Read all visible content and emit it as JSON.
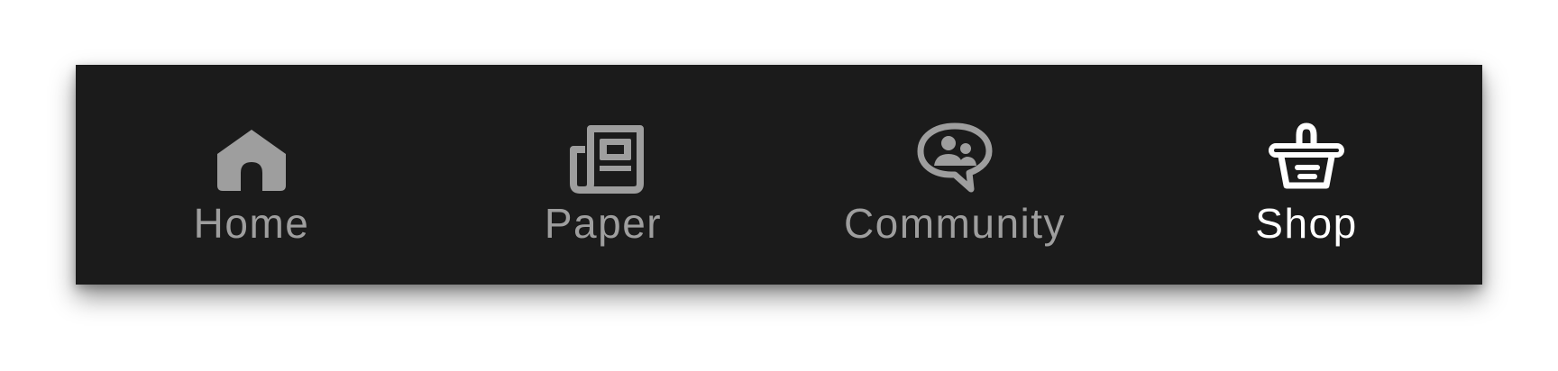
{
  "tab_bar": {
    "selected_index": 3,
    "tabs": [
      {
        "label": "Home",
        "icon": "home-icon",
        "active": false
      },
      {
        "label": "Paper",
        "icon": "newspaper-icon",
        "active": false
      },
      {
        "label": "Community",
        "icon": "community-chat-icon",
        "active": false
      },
      {
        "label": "Shop",
        "icon": "shopping-basket-icon",
        "active": true
      }
    ]
  },
  "colors": {
    "bar_background": "#1b1b1b",
    "inactive": "#9e9e9e",
    "active": "#ffffff",
    "page_background": "#ffffff"
  }
}
